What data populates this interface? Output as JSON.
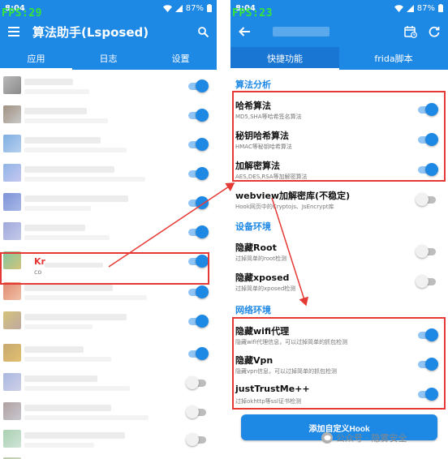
{
  "status_bar": {
    "time": "8:04",
    "battery": "87%"
  },
  "left": {
    "fps": "FPS:29",
    "title": "算法助手(Lsposed)",
    "tabs": [
      "应用",
      "日志",
      "设置"
    ],
    "highlighted_app": {
      "name": "Kr",
      "package": "co"
    }
  },
  "right": {
    "fps": "FPS:23",
    "tabs": [
      "快捷功能",
      "frida脚本"
    ],
    "sections": {
      "algo": "算法分析",
      "device": "设备环境",
      "network": "网络环境"
    },
    "hooks": [
      {
        "title": "哈希算法",
        "desc": "MD5,SHA等哈希签名算法",
        "on": true
      },
      {
        "title": "秘钥哈希算法",
        "desc": "HMAC等秘钥哈希算法",
        "on": true
      },
      {
        "title": "加解密算法",
        "desc": "AES,DES,RSA等加解密算法",
        "on": true
      },
      {
        "title": "webview加解密库(不稳定)",
        "desc": "Hook网页中的Cryptojs、JsEncrypt库",
        "on": false
      },
      {
        "title": "隐藏Root",
        "desc": "过掉简单的root检测",
        "on": false
      },
      {
        "title": "隐藏xposed",
        "desc": "过掉简单的xposed检测",
        "on": false
      },
      {
        "title": "隐藏wifi代理",
        "desc": "隐藏wifi代理信息，可以过掉简单的抓包检测",
        "on": true
      },
      {
        "title": "隐藏Vpn",
        "desc": "隐藏vpn信息，可以过掉简单的抓包检测",
        "on": true
      },
      {
        "title": "justTrustMe++",
        "desc": "过掉okhttp等ssl证书检测",
        "on": true
      }
    ],
    "add_button": "添加自定义Hook"
  },
  "watermark": "公众号 · 隐雾安全",
  "colors": {
    "primary": "#1e88e5",
    "highlight": "#e53935",
    "fps": "#35e635"
  },
  "left_switches": [
    true,
    true,
    true,
    true,
    true,
    true,
    true,
    true,
    true,
    true,
    false,
    false,
    false,
    false
  ]
}
